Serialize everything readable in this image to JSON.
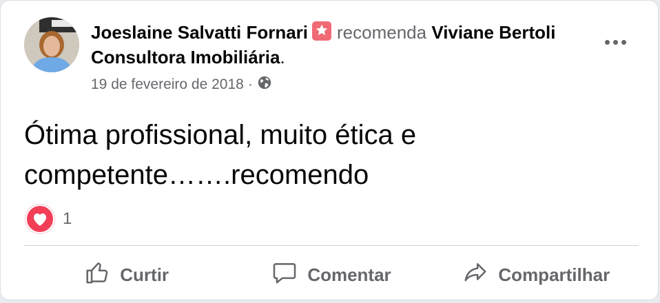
{
  "post": {
    "author_name": "Joeslaine Salvatti Fornari",
    "verb": "recomenda",
    "page_name": "Viviane Bertoli Consultora Imobiliária",
    "page_name_suffix": ".",
    "date": "19 de fevereiro de 2018",
    "date_separator": "·",
    "body": "Ótima profissional, muito ética e competente…….recomendo",
    "reaction_count": "1"
  },
  "actions": {
    "like_label": "Curtir",
    "comment_label": "Comentar",
    "share_label": "Compartilhar"
  },
  "colors": {
    "recommend_badge": "#f06a75",
    "love_reaction": "#f33e58",
    "secondary_text": "#65676b"
  },
  "icons": [
    "recommend-star-icon",
    "globe-icon",
    "more-options-icon",
    "love-reaction-icon",
    "like-icon",
    "comment-icon",
    "share-icon"
  ]
}
